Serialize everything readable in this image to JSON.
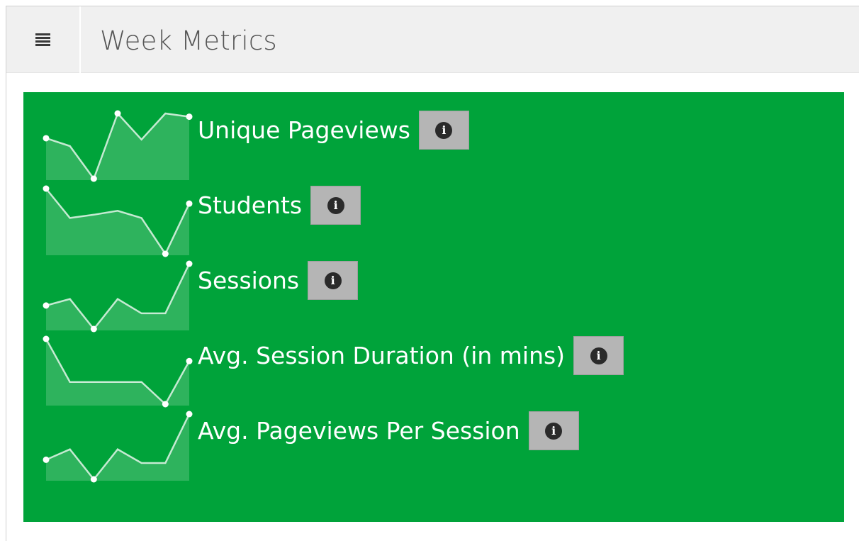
{
  "header": {
    "title": "Week Metrics",
    "menu_icon": "hamburger-menu-icon"
  },
  "panel": {
    "background": "#00a33a",
    "metrics": [
      {
        "label": "Unique Pageviews",
        "info_icon": "info-icon",
        "info_glyph": "i",
        "sparkline": [
          0.62,
          0.5,
          0.0,
          1.0,
          0.6,
          1.0,
          0.95
        ]
      },
      {
        "label": "Students",
        "info_icon": "info-icon",
        "info_glyph": "i",
        "sparkline": [
          1.0,
          0.55,
          0.6,
          0.66,
          0.55,
          0.0,
          0.77
        ]
      },
      {
        "label": "Sessions",
        "info_icon": "info-icon",
        "info_glyph": "i",
        "sparkline": [
          0.36,
          0.46,
          0.0,
          0.46,
          0.24,
          0.24,
          1.0
        ]
      },
      {
        "label": "Avg. Session Duration (in mins)",
        "info_icon": "info-icon",
        "info_glyph": "i",
        "sparkline": [
          1.0,
          0.34,
          0.34,
          0.34,
          0.34,
          0.0,
          0.66
        ]
      },
      {
        "label": "Avg. Pageviews Per Session",
        "info_icon": "info-icon",
        "info_glyph": "i",
        "sparkline": [
          0.3,
          0.46,
          0.0,
          0.46,
          0.25,
          0.25,
          1.0
        ]
      }
    ]
  }
}
